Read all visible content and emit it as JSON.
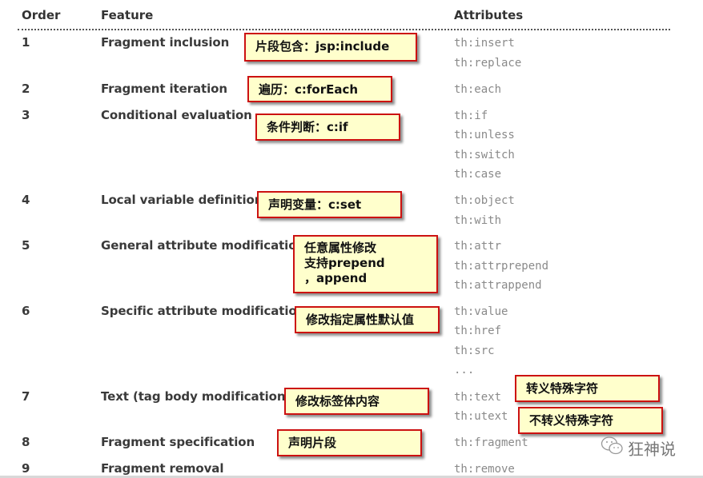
{
  "table": {
    "headers": {
      "order": "Order",
      "feature": "Feature",
      "attributes": "Attributes"
    },
    "rows": [
      {
        "order": "1",
        "feature": "Fragment inclusion",
        "attributes": [
          "th:insert",
          "th:replace"
        ]
      },
      {
        "order": "2",
        "feature": "Fragment iteration",
        "attributes": [
          "th:each"
        ]
      },
      {
        "order": "3",
        "feature": "Conditional evaluation",
        "attributes": [
          "th:if",
          "th:unless",
          "th:switch",
          "th:case"
        ]
      },
      {
        "order": "4",
        "feature": "Local variable definition",
        "attributes": [
          "th:object",
          "th:with"
        ]
      },
      {
        "order": "5",
        "feature": "General attribute modification",
        "attributes": [
          "th:attr",
          "th:attrprepend",
          "th:attrappend"
        ]
      },
      {
        "order": "6",
        "feature": "Specific attribute modification",
        "attributes": [
          "th:value",
          "th:href",
          "th:src",
          "..."
        ]
      },
      {
        "order": "7",
        "feature": "Text (tag body modification)",
        "attributes": [
          "th:text",
          "th:utext"
        ]
      },
      {
        "order": "8",
        "feature": "Fragment specification",
        "attributes": [
          "th:fragment"
        ]
      },
      {
        "order": "9",
        "feature": "Fragment removal",
        "attributes": [
          "th:remove"
        ]
      }
    ]
  },
  "annotations": {
    "fragment_inclusion": "片段包含：jsp:include",
    "iteration": "遍历：c:forEach",
    "conditional": "条件判断：c:if",
    "local_variable": "声明变量：c:set",
    "general_attr": "任意属性修改\n支持prepend\n，append",
    "specific_attr": "修改指定属性默认值",
    "text_body": "修改标签体内容",
    "text_escape": "转义特殊字符",
    "utext_no_escape": "不转义特殊字符",
    "fragment_spec": "声明片段"
  },
  "watermark": {
    "icon": "wechat-icon",
    "text": "狂神说"
  },
  "colors": {
    "note_bg": "#ffffcc",
    "note_border": "#cc1111",
    "attr_text": "#8a8a8a"
  }
}
